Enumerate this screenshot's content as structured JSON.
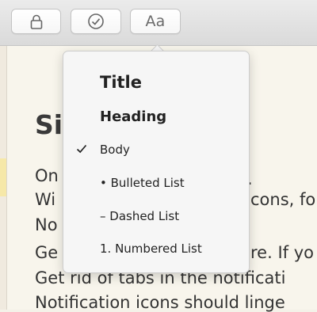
{
  "toolbar": {
    "lock_icon": "lock-icon",
    "checklist_icon": "checkmark-circle-icon",
    "format_label": "Aa"
  },
  "note": {
    "title": "Si",
    "lines": [
      "On",
      "Wi",
      "No",
      "Ge",
      "Get rid of tabs in the notificati",
      "Notification icons should linge"
    ],
    "fragments": [
      ".",
      "cons, fo",
      "re. If yo"
    ]
  },
  "format_menu": {
    "items": [
      {
        "label": "Title",
        "checked": false
      },
      {
        "label": "Heading",
        "checked": false
      },
      {
        "label": "Body",
        "checked": true
      },
      {
        "label": "• Bulleted List",
        "checked": false
      },
      {
        "label": "– Dashed List",
        "checked": false
      },
      {
        "label": "1. Numbered List",
        "checked": false
      }
    ]
  },
  "colors": {
    "toolbar": "#dedede",
    "paper": "#f8f5ec",
    "popover": "#f6f6f6",
    "sidebar_highlight": "#f6e8a8"
  }
}
